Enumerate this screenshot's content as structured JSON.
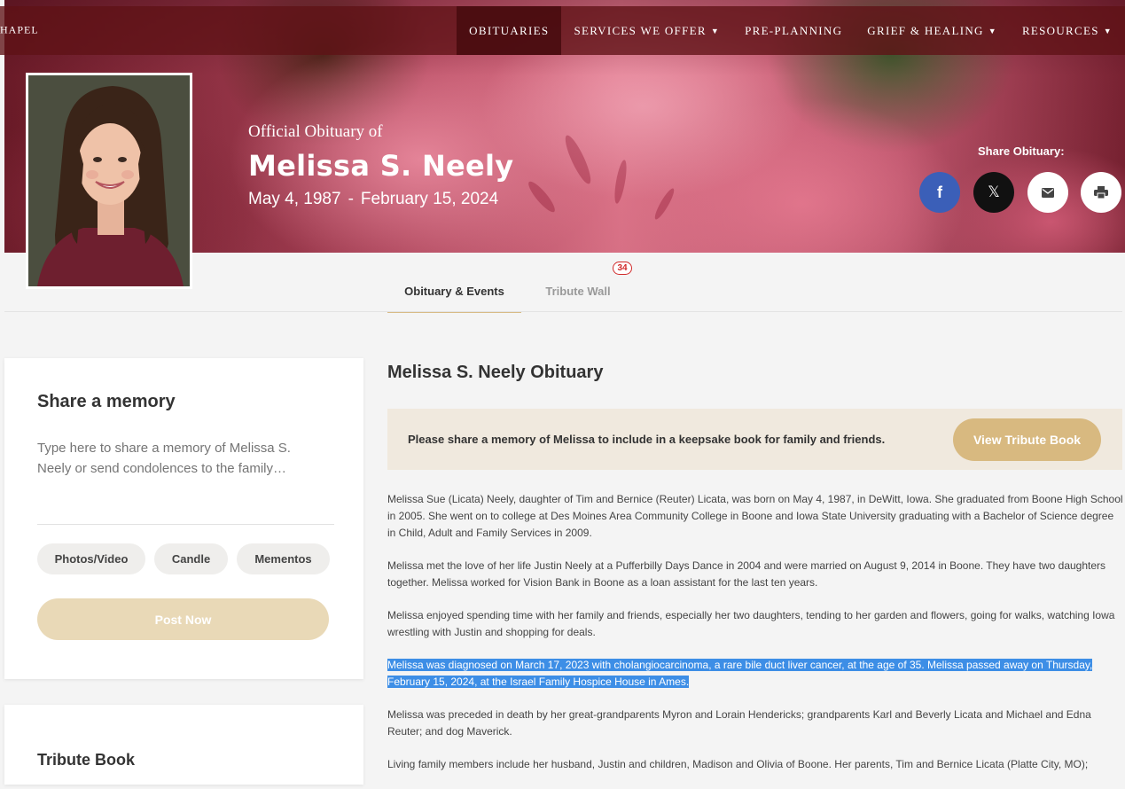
{
  "nav": {
    "brand": "HAPEL",
    "items": [
      {
        "label": "OBITUARIES",
        "active": true,
        "dropdown": false
      },
      {
        "label": "SERVICES WE OFFER",
        "active": false,
        "dropdown": true
      },
      {
        "label": "PRE-PLANNING",
        "active": false,
        "dropdown": false
      },
      {
        "label": "GRIEF & HEALING",
        "active": false,
        "dropdown": true
      },
      {
        "label": "RESOURCES",
        "active": false,
        "dropdown": true
      }
    ]
  },
  "hero": {
    "official": "Official Obituary of",
    "name": "Melissa S. Neely",
    "birth": "May 4, 1987",
    "dash": "-",
    "death": "February 15, 2024",
    "share_label": "Share Obituary:"
  },
  "tabs": {
    "obituary": "Obituary & Events",
    "tribute": "Tribute Wall",
    "tribute_count": "34"
  },
  "memory": {
    "title": "Share a memory",
    "placeholder": "Type here to share a memory of Melissa S. Neely or send condolences to the family…",
    "photos": "Photos/Video",
    "candle": "Candle",
    "mementos": "Mementos",
    "post": "Post Now"
  },
  "tribute_book": {
    "title": "Tribute Book"
  },
  "main": {
    "title": "Melissa S. Neely Obituary",
    "tribute_msg": "Please share a memory of Melissa to include in a keepsake book for family and friends.",
    "view_btn": "View Tribute Book",
    "p1": "Melissa Sue (Licata) Neely, daughter of Tim and Bernice (Reuter) Licata, was born on May 4, 1987, in DeWitt, Iowa. She graduated from Boone High School in 2005. She went on to college at Des Moines Area Community College in Boone and Iowa State University graduating with a Bachelor of Science degree in Child, Adult and Family Services in 2009.",
    "p2": "Melissa met the love of her life Justin Neely at a Pufferbilly Days Dance in 2004 and were married on August 9, 2014 in Boone. They have two daughters together. Melissa worked for Vision Bank in Boone as a loan assistant for the last ten years.",
    "p3": "Melissa enjoyed spending time with her family and friends, especially her two daughters, tending to her garden and flowers, going for walks, watching Iowa wrestling with Justin and shopping for deals.",
    "p4": "Melissa was diagnosed on March 17, 2023 with cholangiocarcinoma, a rare bile duct liver cancer, at the age of 35. Melissa passed away on Thursday, February 15, 2024, at the Israel Family Hospice House in Ames.",
    "p5": "Melissa was preceded in death by her great-grandparents Myron and Lorain Hendericks; grandparents Karl and Beverly Licata and Michael and Edna Reuter; and dog Maverick.",
    "p6": "Living family members include her husband, Justin and children, Madison and Olivia of Boone. Her parents, Tim and Bernice Licata (Platte City, MO);"
  },
  "colors": {
    "nav_bg": "#5f1216",
    "accent_gold": "#d8b980",
    "post_now": "#e9d9b7",
    "facebook": "#3b5fb8",
    "highlight": "#3d8ee6",
    "badge": "#d12a2a"
  }
}
